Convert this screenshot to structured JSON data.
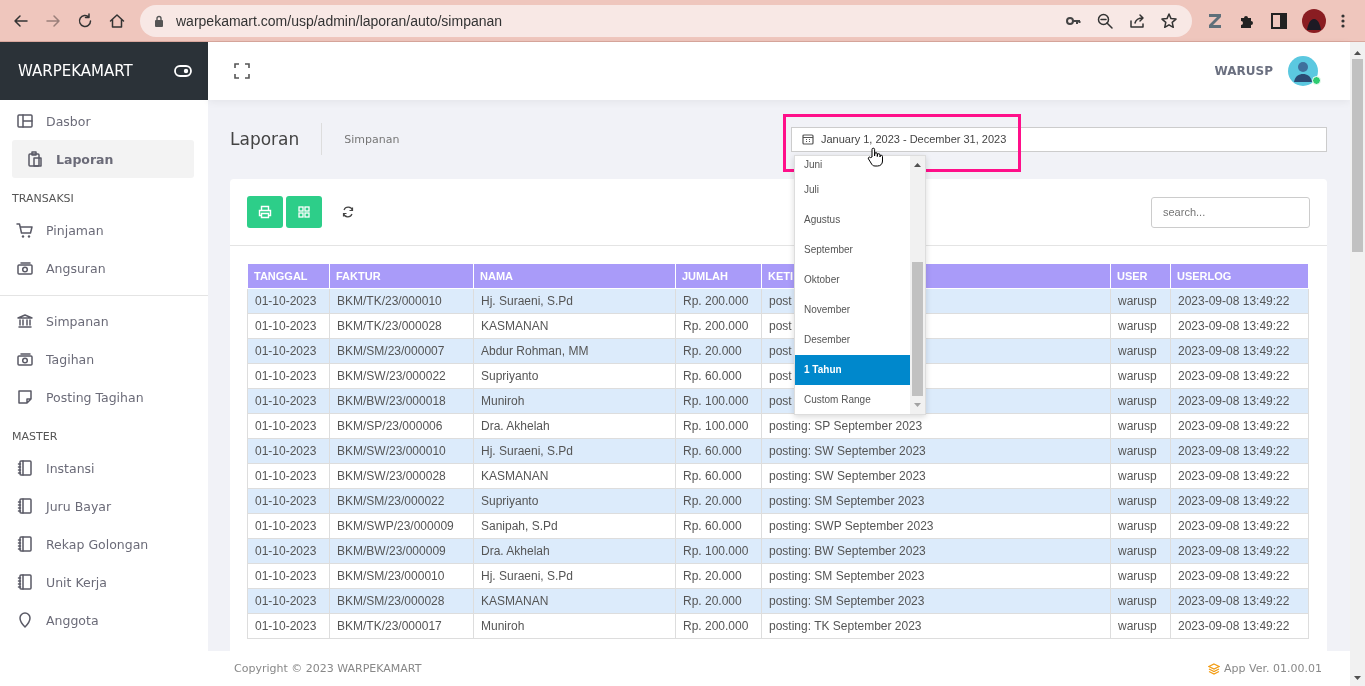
{
  "browser": {
    "url": "warpekamart.com/usp/admin/laporan/auto/simpanan",
    "forward_enabled": false
  },
  "sidebar": {
    "brand": "WARPEKAMART",
    "groups": [
      {
        "items": [
          {
            "label": "Dasbor",
            "selected": false
          },
          {
            "label": "Laporan",
            "selected": true
          }
        ]
      },
      {
        "title": "TRANSAKSI",
        "items": [
          {
            "label": "Pinjaman",
            "selected": false
          },
          {
            "label": "Angsuran",
            "selected": false
          }
        ]
      },
      {
        "divider": true,
        "items": [
          {
            "label": "Simpanan",
            "selected": false
          },
          {
            "label": "Tagihan",
            "selected": false
          },
          {
            "label": "Posting Tagihan",
            "selected": false
          }
        ]
      },
      {
        "title": "MASTER",
        "items": [
          {
            "label": "Instansi",
            "selected": false
          },
          {
            "label": "Juru Bayar",
            "selected": false
          },
          {
            "label": "Rekap Golongan",
            "selected": false
          },
          {
            "label": "Unit Kerja",
            "selected": false
          },
          {
            "label": "Anggota",
            "selected": false
          }
        ]
      }
    ]
  },
  "topbar": {
    "user": "WARUSP",
    "online": true
  },
  "page": {
    "title": "Laporan",
    "subtitle": "Simpanan",
    "date_range": "January 1, 2023 - December 31, 2023",
    "range_options": [
      {
        "label": "Juni",
        "selected": false
      },
      {
        "label": "Juli",
        "selected": false
      },
      {
        "label": "Agustus",
        "selected": false
      },
      {
        "label": "September",
        "selected": false
      },
      {
        "label": "Oktober",
        "selected": false
      },
      {
        "label": "November",
        "selected": false
      },
      {
        "label": "Desember",
        "selected": false
      },
      {
        "label": "1 Tahun",
        "selected": true
      },
      {
        "label": "Custom Range",
        "selected": false
      }
    ]
  },
  "search": {
    "placeholder": "search..."
  },
  "table": {
    "columns": [
      "TANGGAL",
      "FAKTUR",
      "NAMA",
      "JUMLAH",
      "KETI",
      "USER",
      "USERLOG"
    ],
    "rows": [
      [
        "01-10-2023",
        "BKM/TK/23/000010",
        "Hj. Suraeni, S.Pd",
        "Rp. 200.000",
        "post",
        "warusp",
        "2023-09-08 13:49:22"
      ],
      [
        "01-10-2023",
        "BKM/TK/23/000028",
        "KASMANAN",
        "Rp. 200.000",
        "post",
        "warusp",
        "2023-09-08 13:49:22"
      ],
      [
        "01-10-2023",
        "BKM/SM/23/000007",
        "Abdur Rohman, MM",
        "Rp. 20.000",
        "post",
        "warusp",
        "2023-09-08 13:49:22"
      ],
      [
        "01-10-2023",
        "BKM/SW/23/000022",
        "Supriyanto",
        "Rp. 60.000",
        "post",
        "warusp",
        "2023-09-08 13:49:22"
      ],
      [
        "01-10-2023",
        "BKM/BW/23/000018",
        "Muniroh",
        "Rp. 100.000",
        "post",
        "warusp",
        "2023-09-08 13:49:22"
      ],
      [
        "01-10-2023",
        "BKM/SP/23/000006",
        "Dra. Akhelah",
        "Rp. 100.000",
        "posting: SP September 2023",
        "warusp",
        "2023-09-08 13:49:22"
      ],
      [
        "01-10-2023",
        "BKM/SW/23/000010",
        "Hj. Suraeni, S.Pd",
        "Rp. 60.000",
        "posting: SW September 2023",
        "warusp",
        "2023-09-08 13:49:22"
      ],
      [
        "01-10-2023",
        "BKM/SW/23/000028",
        "KASMANAN",
        "Rp. 60.000",
        "posting: SW September 2023",
        "warusp",
        "2023-09-08 13:49:22"
      ],
      [
        "01-10-2023",
        "BKM/SM/23/000022",
        "Supriyanto",
        "Rp. 20.000",
        "posting: SM September 2023",
        "warusp",
        "2023-09-08 13:49:22"
      ],
      [
        "01-10-2023",
        "BKM/SWP/23/000009",
        "Sanipah, S.Pd",
        "Rp. 60.000",
        "posting: SWP September 2023",
        "warusp",
        "2023-09-08 13:49:22"
      ],
      [
        "01-10-2023",
        "BKM/BW/23/000009",
        "Dra. Akhelah",
        "Rp. 100.000",
        "posting: BW September 2023",
        "warusp",
        "2023-09-08 13:49:22"
      ],
      [
        "01-10-2023",
        "BKM/SM/23/000010",
        "Hj. Suraeni, S.Pd",
        "Rp. 20.000",
        "posting: SM September 2023",
        "warusp",
        "2023-09-08 13:49:22"
      ],
      [
        "01-10-2023",
        "BKM/SM/23/000028",
        "KASMANAN",
        "Rp. 20.000",
        "posting: SM September 2023",
        "warusp",
        "2023-09-08 13:49:22"
      ],
      [
        "01-10-2023",
        "BKM/TK/23/000017",
        "Muniroh",
        "Rp. 200.000",
        "posting: TK September 2023",
        "warusp",
        "2023-09-08 13:49:22"
      ]
    ]
  },
  "footer": {
    "copyright": "Copyright © 2023 WARPEKAMART",
    "version": "App Ver. 01.00.01"
  }
}
